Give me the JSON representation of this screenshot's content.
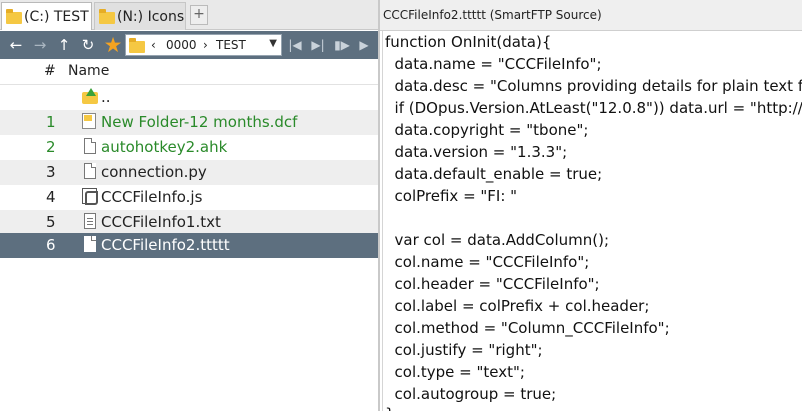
{
  "tabs": [
    {
      "label": "(C:) TEST",
      "active": true
    },
    {
      "label": "(N:) Icons",
      "active": false
    }
  ],
  "tab_add_label": "+",
  "nav": {
    "back": "←",
    "forward": "→",
    "up": "↑",
    "refresh": "↻",
    "favorites": "★",
    "path_segments": [
      "‹",
      "0000",
      "›",
      "TEST"
    ],
    "path_dropdown": "▼",
    "media": [
      "|◀",
      "▶|",
      "▮▶",
      "▶"
    ]
  },
  "columns": {
    "number": "#",
    "name": "Name"
  },
  "rows": [
    {
      "num": "",
      "name": "..",
      "icon": "parent-folder-icon"
    },
    {
      "num": "1",
      "name": "New Folder-12 months.dcf",
      "icon": "dcf-file-icon",
      "color": "#2a8a2a"
    },
    {
      "num": "2",
      "name": "autohotkey2.ahk",
      "icon": "document-icon",
      "color": "#2a8a2a"
    },
    {
      "num": "3",
      "name": "connection.py",
      "icon": "document-icon"
    },
    {
      "num": "4",
      "name": "CCCFileInfo.js",
      "icon": "script-file-icon"
    },
    {
      "num": "5",
      "name": "CCCFileInfo1.txt",
      "icon": "text-file-icon"
    },
    {
      "num": "6",
      "name": "CCCFileInfo2.ttttt",
      "icon": "document-icon",
      "selected": true
    }
  ],
  "viewer": {
    "title": "CCCFileInfo2.ttttt (SmartFTP Source)",
    "lines": [
      "function OnInit(data){",
      "  data.name = \"CCCFileInfo\";",
      "  data.desc = \"Columns providing details for plain text f",
      "  if (DOpus.Version.AtLeast(\"12.0.8\")) data.url = \"http://",
      "  data.copyright = \"tbone\";",
      "  data.version = \"1.3.3\";",
      "  data.default_enable = true;",
      "  colPrefix = \"FI: \"",
      "",
      "  var col = data.AddColumn();",
      "  col.name = \"CCCFileInfo\";",
      "  col.header = \"CCCFileInfo\";",
      "  col.label = colPrefix + col.header;",
      "  col.method = \"Column_CCCFileInfo\";",
      "  col.justify = \"right\";",
      "  col.type = \"text\";",
      "  col.autogroup = true;",
      "}"
    ]
  },
  "colors": {
    "toolbar": "#5d6f7f",
    "selection": "#5d6f7f",
    "green_text": "#2a8a2a",
    "star": "#f4a321",
    "folder": "#f5c843"
  }
}
